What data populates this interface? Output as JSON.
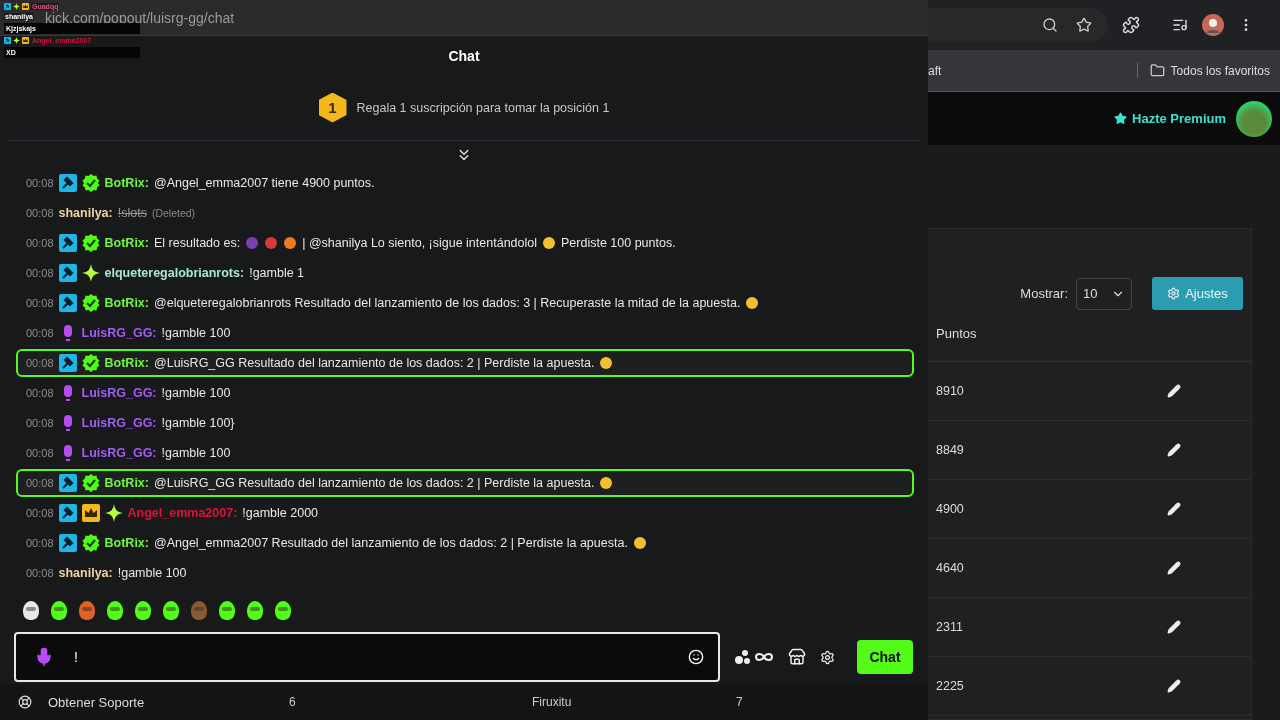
{
  "overlay": [
    {
      "user": "Guadqq",
      "color": "#e0507a",
      "badges": [
        {
          "kind": "moderator"
        },
        {
          "kind": "sub"
        },
        {
          "kind": "vip"
        }
      ]
    },
    {
      "user": "shanilya",
      "text": "Kjzjskajs"
    },
    {
      "user": "Angel_emma2007",
      "color": "#d0143c",
      "badges": [
        {
          "kind": "moderator"
        },
        {
          "kind": "sub"
        },
        {
          "kind": "vip"
        }
      ],
      "text": "XD"
    }
  ],
  "popup": {
    "url": "kick.com/popout/luisrg-gg/chat",
    "title": "Chat"
  },
  "pinned": {
    "rank": "1",
    "text": "Regala 1 suscripción para tomar la posición 1"
  },
  "messages": [
    {
      "time": "00:08",
      "badges": [
        {
          "kind": "moderator"
        },
        {
          "kind": "verified"
        }
      ],
      "user": "BotRix:",
      "color": "#75f24b",
      "highlighted": false,
      "deleted": false,
      "segments": [
        {
          "kind": "text",
          "text": "@Angel_emma2007 tiene 4900 puntos."
        }
      ]
    },
    {
      "time": "00:08",
      "user": "shanilya:",
      "color": "#f5d3a0",
      "highlighted": false,
      "deleted": true,
      "deleted_label": "(Deleted)",
      "segments": [
        {
          "kind": "text",
          "text": "!slots"
        }
      ]
    },
    {
      "time": "00:08",
      "badges": [
        {
          "kind": "moderator"
        },
        {
          "kind": "verified"
        }
      ],
      "user": "BotRix:",
      "color": "#75f24b",
      "highlighted": false,
      "deleted": false,
      "segments": [
        {
          "kind": "text",
          "text": "El resultado es:"
        },
        {
          "kind": "emote",
          "color": "#7b3fb0"
        },
        {
          "kind": "emote",
          "color": "#d8383a"
        },
        {
          "kind": "emote",
          "color": "#f07a20"
        },
        {
          "kind": "text",
          "text": "| @shanilya Lo siento, ¡sigue intentándolol"
        },
        {
          "kind": "emote",
          "color": "#f0c030"
        },
        {
          "kind": "text",
          "text": "Perdiste 100 puntos."
        }
      ]
    },
    {
      "time": "00:08",
      "badges": [
        {
          "kind": "moderator"
        },
        {
          "kind": "sub"
        }
      ],
      "user": "elqueteregalobrianrots:",
      "color": "#a8ead0",
      "highlighted": false,
      "deleted": false,
      "segments": [
        {
          "kind": "text",
          "text": "!gamble 1"
        }
      ]
    },
    {
      "time": "00:08",
      "badges": [
        {
          "kind": "moderator"
        },
        {
          "kind": "verified"
        }
      ],
      "user": "BotRix:",
      "color": "#75f24b",
      "highlighted": false,
      "deleted": false,
      "segments": [
        {
          "kind": "text",
          "text": "@elqueteregalobrianrots Resultado del lanzamiento de los dados: 3 | Recuperaste la mitad de la apuesta."
        },
        {
          "kind": "emote",
          "color": "#f0c030"
        }
      ]
    },
    {
      "time": "00:08",
      "badges": [
        {
          "kind": "broadcaster"
        }
      ],
      "user": "LuisRG_GG:",
      "color": "#a35cf0",
      "highlighted": false,
      "deleted": false,
      "segments": [
        {
          "kind": "text",
          "text": "!gamble 100"
        }
      ]
    },
    {
      "time": "00:08",
      "badges": [
        {
          "kind": "moderator"
        },
        {
          "kind": "verified"
        }
      ],
      "user": "BotRix:",
      "color": "#75f24b",
      "highlighted": true,
      "deleted": false,
      "segments": [
        {
          "kind": "text",
          "text": "@LuisRG_GG Resultado del lanzamiento de los dados: 2 | Perdiste la apuesta."
        },
        {
          "kind": "emote",
          "color": "#f0c030"
        }
      ]
    },
    {
      "time": "00:08",
      "badges": [
        {
          "kind": "broadcaster"
        }
      ],
      "user": "LuisRG_GG:",
      "color": "#a35cf0",
      "highlighted": false,
      "deleted": false,
      "segments": [
        {
          "kind": "text",
          "text": "!gamble 100"
        }
      ]
    },
    {
      "time": "00:08",
      "badges": [
        {
          "kind": "broadcaster"
        }
      ],
      "user": "LuisRG_GG:",
      "color": "#a35cf0",
      "highlighted": false,
      "deleted": false,
      "segments": [
        {
          "kind": "text",
          "text": "!gamble 100}"
        }
      ]
    },
    {
      "time": "00:08",
      "badges": [
        {
          "kind": "broadcaster"
        }
      ],
      "user": "LuisRG_GG:",
      "color": "#a35cf0",
      "highlighted": false,
      "deleted": false,
      "segments": [
        {
          "kind": "text",
          "text": "!gamble 100"
        }
      ]
    },
    {
      "time": "00:08",
      "badges": [
        {
          "kind": "moderator"
        },
        {
          "kind": "verified"
        }
      ],
      "user": "BotRix:",
      "color": "#75f24b",
      "highlighted": true,
      "deleted": false,
      "segments": [
        {
          "kind": "text",
          "text": "@LuisRG_GG Resultado del lanzamiento de los dados: 2 | Perdiste la apuesta."
        },
        {
          "kind": "emote",
          "color": "#f0c030"
        }
      ]
    },
    {
      "time": "00:08",
      "badges": [
        {
          "kind": "moderator"
        },
        {
          "kind": "vip"
        },
        {
          "kind": "sub"
        }
      ],
      "user": "Angel_emma2007:",
      "color": "#d8143c",
      "highlighted": false,
      "deleted": false,
      "segments": [
        {
          "kind": "text",
          "text": "!gamble 2000"
        }
      ]
    },
    {
      "time": "00:08",
      "badges": [
        {
          "kind": "moderator"
        },
        {
          "kind": "verified"
        }
      ],
      "user": "BotRix:",
      "color": "#75f24b",
      "highlighted": false,
      "deleted": false,
      "segments": [
        {
          "kind": "text",
          "text": "@Angel_emma2007 Resultado del lanzamiento de los dados: 2 | Perdiste la apuesta."
        },
        {
          "kind": "emote",
          "color": "#f0c030"
        }
      ]
    },
    {
      "time": "00:08",
      "user": "shanilya:",
      "color": "#f5d3a0",
      "highlighted": false,
      "deleted": false,
      "segments": [
        {
          "kind": "text",
          "text": "!gamble 100"
        }
      ]
    }
  ],
  "input": {
    "value": "!"
  },
  "send_button": "Chat",
  "background_row": {
    "sidebar_item": "Obtener Soporte",
    "cells": [
      "6",
      "Firuxitu",
      "7"
    ]
  },
  "browser": {
    "bookmark": "aft",
    "bookmarks_folder": "Todos los favoritos"
  },
  "site": {
    "premium": "Hazte Premium"
  },
  "points_panel": {
    "show_label": "Mostrar:",
    "show_value": "10",
    "settings_button": "Ajustes",
    "column": "Puntos",
    "rows": [
      "8910",
      "8849",
      "4900",
      "4640",
      "2311",
      "2225"
    ]
  }
}
